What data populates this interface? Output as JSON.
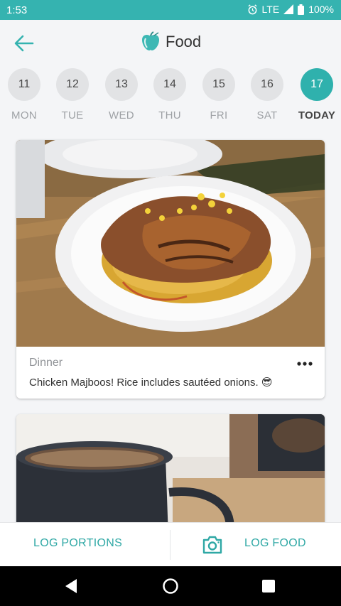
{
  "status": {
    "time": "1:53",
    "network": "LTE",
    "battery": "100%"
  },
  "header": {
    "title": "Food"
  },
  "days": [
    {
      "num": "11",
      "label": "MON",
      "active": false
    },
    {
      "num": "12",
      "label": "TUE",
      "active": false
    },
    {
      "num": "13",
      "label": "WED",
      "active": false
    },
    {
      "num": "14",
      "label": "THU",
      "active": false
    },
    {
      "num": "15",
      "label": "FRI",
      "active": false
    },
    {
      "num": "16",
      "label": "SAT",
      "active": false
    },
    {
      "num": "17",
      "label": "TODAY",
      "active": true
    }
  ],
  "entries": [
    {
      "meal": "Dinner",
      "caption": "Chicken Majboos! Rice includes sautéed onions. 😎"
    }
  ],
  "bottom": {
    "log_portions": "LOG PORTIONS",
    "log_food": "LOG FOOD"
  },
  "colors": {
    "accent": "#35b3b0",
    "active_day": "#2fb1ad",
    "action_text": "#2fa8a5"
  }
}
